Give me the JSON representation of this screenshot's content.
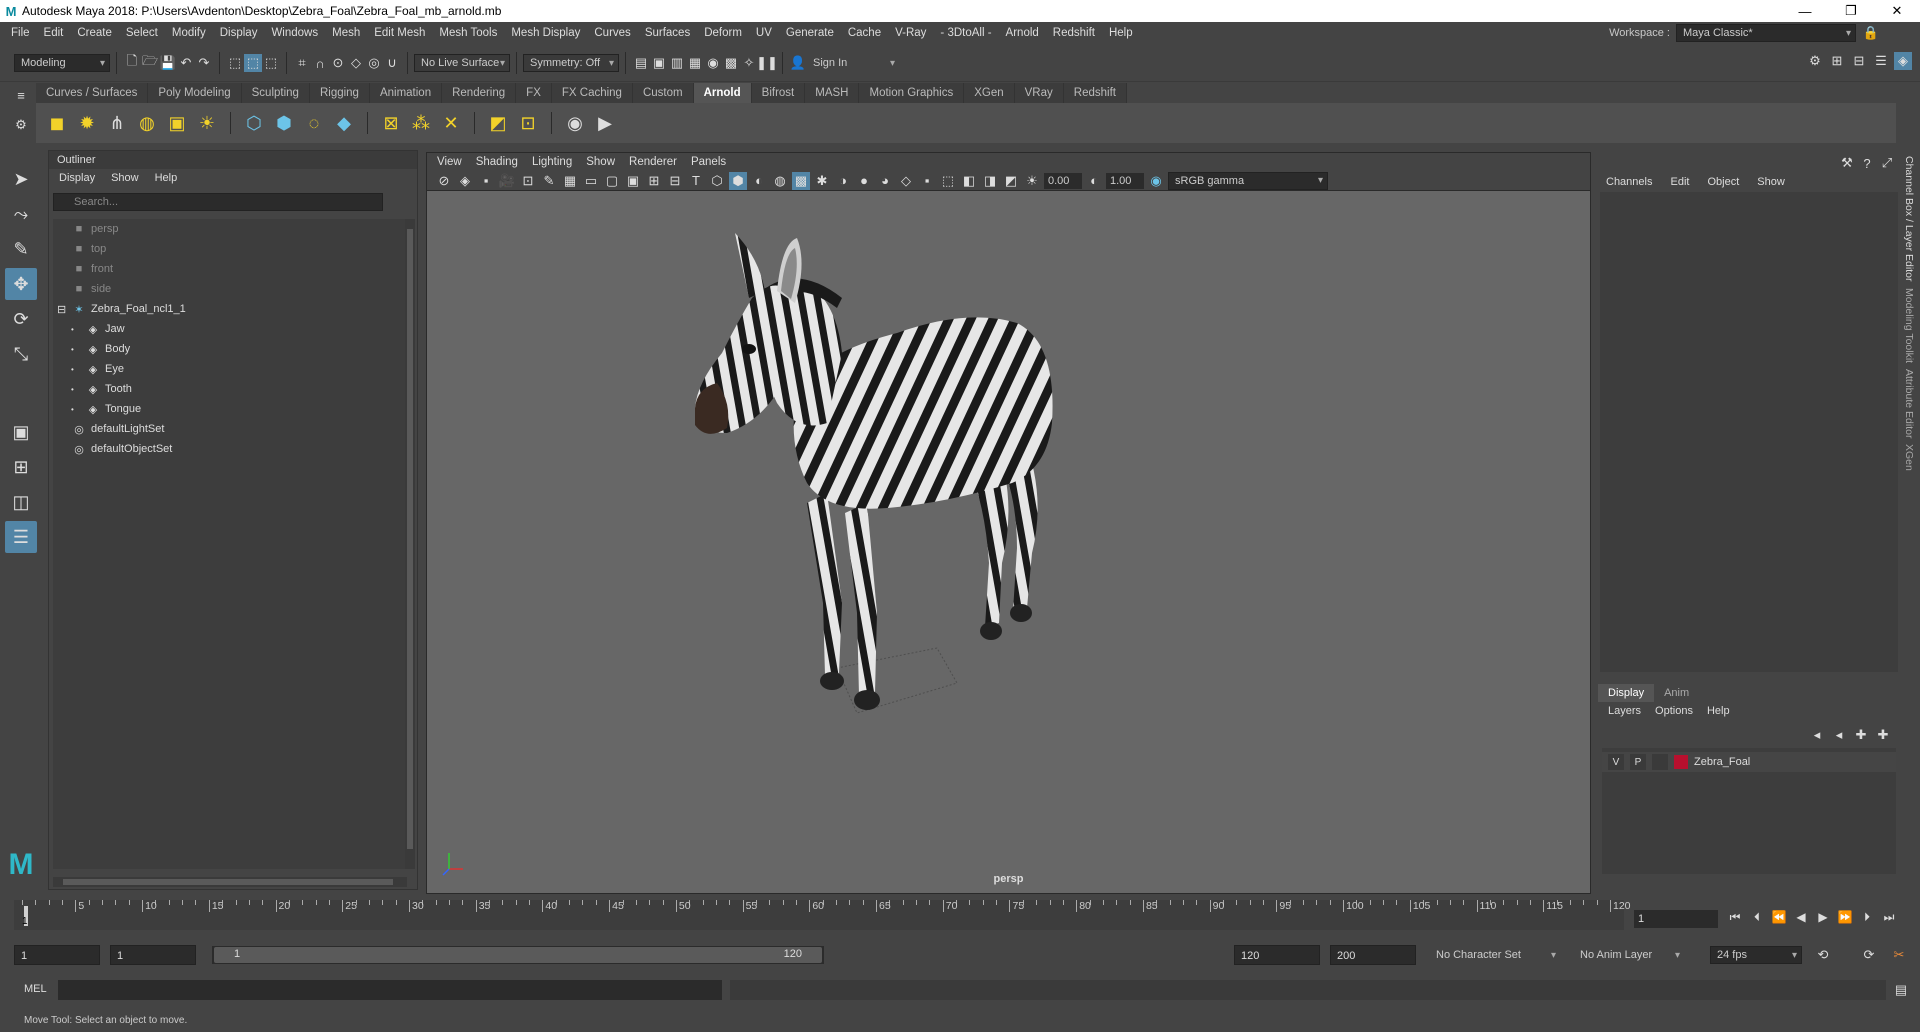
{
  "window": {
    "title": "Autodesk Maya 2018: P:\\Users\\Avdenton\\Desktop\\Zebra_Foal\\Zebra_Foal_mb_arnold.mb",
    "logo": "M",
    "minimize": "—",
    "maximize": "❐",
    "close": "✕"
  },
  "menubar": [
    "File",
    "Edit",
    "Create",
    "Select",
    "Modify",
    "Display",
    "Windows",
    "Mesh",
    "Edit Mesh",
    "Mesh Tools",
    "Mesh Display",
    "Curves",
    "Surfaces",
    "Deform",
    "UV",
    "Generate",
    "Cache",
    "V-Ray",
    "- 3DtoAll -",
    "Arnold",
    "Redshift",
    "Help"
  ],
  "workspace": {
    "label": "Workspace :",
    "value": "Maya Classic*"
  },
  "statusline": {
    "mode": "Modeling",
    "live_surface": "No Live Surface",
    "symmetry": "Symmetry: Off",
    "sign_in": "Sign In"
  },
  "shelf_tabs": [
    "Curves / Surfaces",
    "Poly Modeling",
    "Sculpting",
    "Rigging",
    "Animation",
    "Rendering",
    "FX",
    "FX Caching",
    "Custom",
    "Arnold",
    "Bifrost",
    "MASH",
    "Motion Graphics",
    "XGen",
    "VRay",
    "Redshift"
  ],
  "active_shelf_tab": "Arnold",
  "outliner": {
    "title": "Outliner",
    "menu": [
      "Display",
      "Show",
      "Help"
    ],
    "search_placeholder": "Search...",
    "items": [
      {
        "label": "persp",
        "icon": "camera-icon",
        "indent": 0,
        "dim": true
      },
      {
        "label": "top",
        "icon": "camera-icon",
        "indent": 0,
        "dim": true
      },
      {
        "label": "front",
        "icon": "camera-icon",
        "indent": 0,
        "dim": true
      },
      {
        "label": "side",
        "icon": "camera-icon",
        "indent": 0,
        "dim": true
      },
      {
        "label": "Zebra_Foal_ncl1_1",
        "icon": "joint-icon",
        "indent": 0,
        "dim": false,
        "expander": "⊟"
      },
      {
        "label": "Jaw",
        "icon": "mesh-icon",
        "indent": 1,
        "dim": false
      },
      {
        "label": "Body",
        "icon": "mesh-icon",
        "indent": 1,
        "dim": false
      },
      {
        "label": "Eye",
        "icon": "mesh-icon",
        "indent": 1,
        "dim": false
      },
      {
        "label": "Tooth",
        "icon": "mesh-icon",
        "indent": 1,
        "dim": false
      },
      {
        "label": "Tongue",
        "icon": "mesh-icon",
        "indent": 1,
        "dim": false
      },
      {
        "label": "defaultLightSet",
        "icon": "set-icon",
        "indent": 0,
        "dim": false
      },
      {
        "label": "defaultObjectSet",
        "icon": "set-icon",
        "indent": 0,
        "dim": false
      }
    ]
  },
  "viewport": {
    "menu": [
      "View",
      "Shading",
      "Lighting",
      "Show",
      "Renderer",
      "Panels"
    ],
    "exposure": "0.00",
    "gamma": "1.00",
    "color_space": "sRGB gamma",
    "camera": "persp"
  },
  "channel_box": {
    "menu": [
      "Channels",
      "Edit",
      "Object",
      "Show"
    ]
  },
  "side_tabs": [
    "Channel Box / Layer Editor",
    "Modeling Toolkit",
    "Attribute Editor",
    "XGen"
  ],
  "layer_editor": {
    "tabs": [
      "Display",
      "Anim"
    ],
    "menu": [
      "Layers",
      "Options",
      "Help"
    ],
    "layer": {
      "v": "V",
      "p": "P",
      "name": "Zebra_Foal",
      "color": "#b8102e"
    }
  },
  "timeline": {
    "ticks": [
      "5",
      "10",
      "15",
      "20",
      "25",
      "30",
      "35",
      "40",
      "45",
      "50",
      "55",
      "60",
      "65",
      "70",
      "75",
      "80",
      "85",
      "90",
      "95",
      "100",
      "105",
      "110",
      "115",
      "120"
    ],
    "start_tick": "1",
    "current_frame": "1"
  },
  "range": {
    "start": "1",
    "playback_start": "1",
    "slider_start": "1",
    "slider_end": "120",
    "playback_end": "120",
    "end": "200",
    "character_set": "No Character Set",
    "anim_layer": "No Anim Layer",
    "fps": "24 fps"
  },
  "mel": {
    "label": "MEL"
  },
  "status_message": "Move Tool: Select an object to move."
}
